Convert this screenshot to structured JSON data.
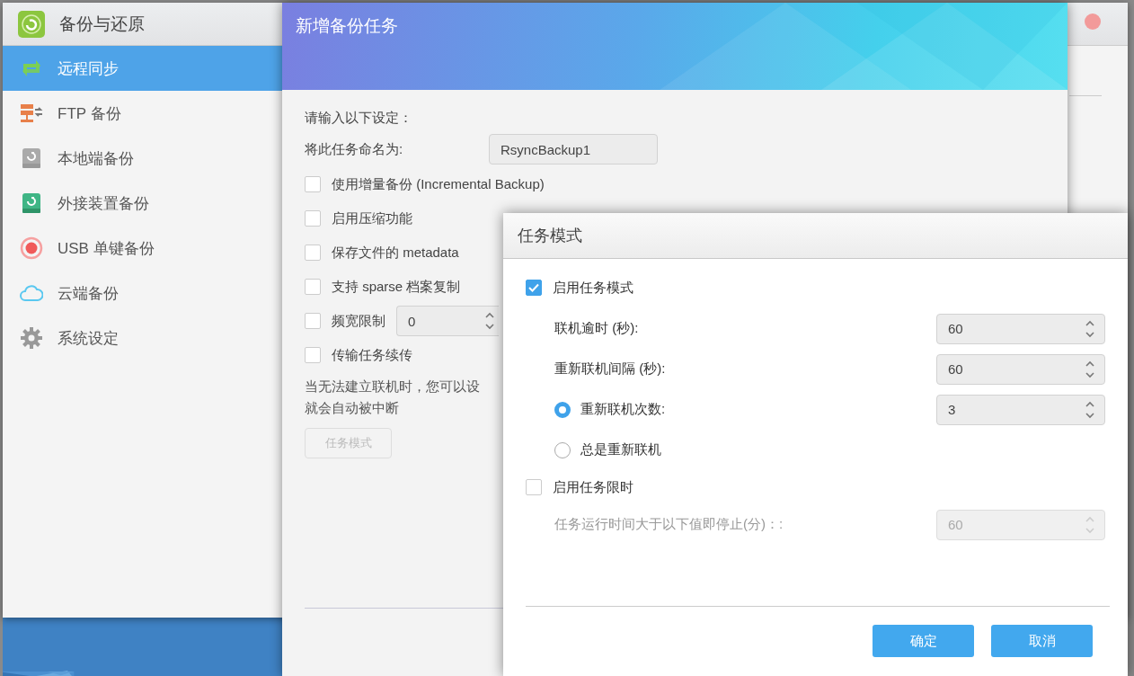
{
  "app": {
    "title": "备份与还原",
    "sidebar": {
      "items": [
        {
          "kind": "sync",
          "label": "远程同步",
          "selected": true
        },
        {
          "kind": "ftp",
          "label": "FTP 备份",
          "selected": false
        },
        {
          "kind": "local",
          "label": "本地端备份",
          "selected": false
        },
        {
          "kind": "external",
          "label": "外接装置备份",
          "selected": false
        },
        {
          "kind": "usb",
          "label": "USB 单键备份",
          "selected": false
        },
        {
          "kind": "cloud",
          "label": "云端备份",
          "selected": false
        },
        {
          "kind": "settings",
          "label": "系统设定",
          "selected": false
        }
      ]
    }
  },
  "task_dialog": {
    "title": "新增备份任务",
    "intro": "请输入以下设定：",
    "name_label": "将此任务命名为:",
    "name_value": "RsyncBackup1",
    "options": [
      {
        "label": "使用增量备份 (Incremental Backup)",
        "checked": false
      },
      {
        "label": "启用压缩功能",
        "checked": false
      },
      {
        "label": "保存文件的 metadata",
        "checked": false
      },
      {
        "label": "支持 sparse 档案复制",
        "checked": false
      },
      {
        "label": "频宽限制",
        "checked": false,
        "value": "0"
      },
      {
        "label": "传输任务续传",
        "checked": false
      }
    ],
    "note_lines": [
      "当无法建立联机时，您可以设",
      "就会自动被中断"
    ],
    "mode_button": {
      "label": "任务模式",
      "disabled": true
    }
  },
  "mode_dialog": {
    "title": "任务模式",
    "enable": {
      "label": "启用任务模式",
      "checked": true
    },
    "fields": [
      {
        "kind": "spin",
        "label": "联机逾时 (秒):",
        "value": "60"
      },
      {
        "kind": "spin",
        "label": "重新联机间隔 (秒):",
        "value": "60"
      },
      {
        "kind": "radio",
        "label": "重新联机次数:",
        "selected": true,
        "value": "3"
      },
      {
        "kind": "radio",
        "label": "总是重新联机",
        "selected": false
      }
    ],
    "limit": {
      "label": "启用任务限时",
      "checked": false
    },
    "limit_field": {
      "label": "任务运行时间大于以下值即停止(分)：:",
      "value": "60",
      "disabled": true
    },
    "buttons": [
      "确定",
      "取消"
    ]
  }
}
